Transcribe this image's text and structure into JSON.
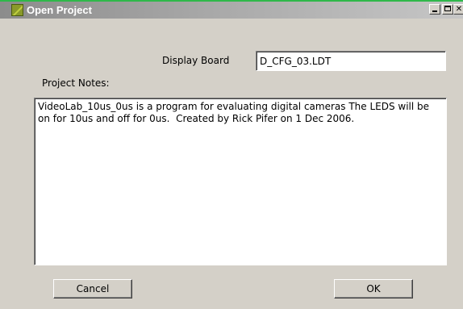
{
  "window": {
    "title": "Open Project",
    "controls": {
      "minimize": "minimize",
      "maximize": "maximize",
      "close": "✕"
    }
  },
  "form": {
    "display_board_label": "Display Board",
    "display_board_value": "D_CFG_03.LDT",
    "project_notes_label": "Project Notes:",
    "project_notes_value": "VideoLab_10us_0us is a program for evaluating digital cameras The LEDS will be on for 10us and off for 0us.  Created by Rick Pifer on 1 Dec 2006."
  },
  "buttons": {
    "cancel": "Cancel",
    "ok": "OK"
  },
  "colors": {
    "title_accent": "#2fb84a",
    "dialog_bg": "#d4d0c8"
  }
}
